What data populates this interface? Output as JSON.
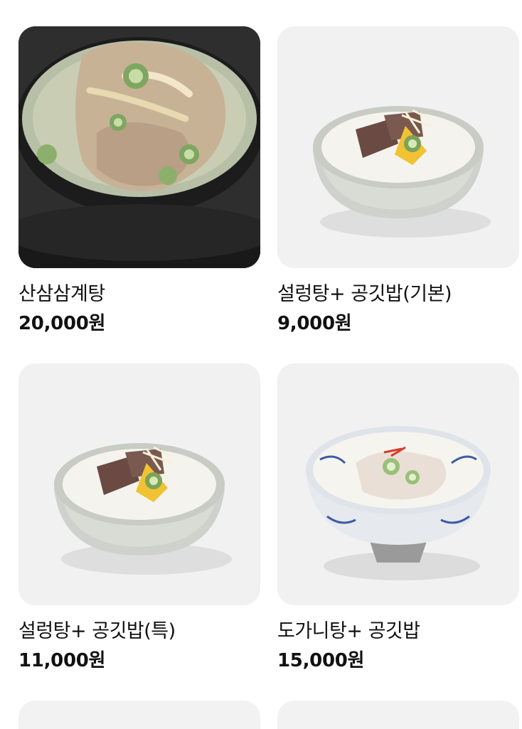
{
  "menu": {
    "items": [
      {
        "name": "산삼삼계탕",
        "price": "20,000원",
        "image_icon": "samgyetang-photo"
      },
      {
        "name": "설렁탕+ 공깃밥(기본)",
        "price": "9,000원",
        "image_icon": "seolleongtang-photo"
      },
      {
        "name": "설렁탕+ 공깃밥(특)",
        "price": "11,000원",
        "image_icon": "seolleongtang-photo"
      },
      {
        "name": "도가니탕+ 공깃밥",
        "price": "15,000원",
        "image_icon": "doganitang-photo"
      }
    ]
  },
  "colors": {
    "text": "#111111",
    "thumb_bg": "#f1f1f1",
    "page_bg": "#ffffff"
  }
}
